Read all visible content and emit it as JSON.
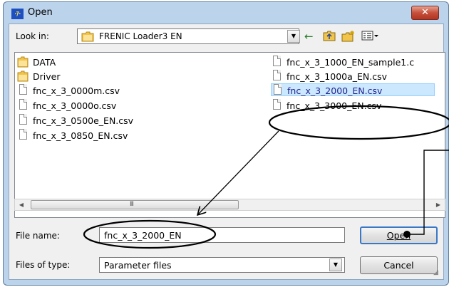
{
  "window": {
    "title": "Open",
    "app_icon_text": "·ｱ·",
    "close_glyph": "✕"
  },
  "look_in": {
    "label": "Look in:",
    "mnemonic_underline": "i",
    "value": "FRENIC Loader3 EN"
  },
  "toolbar": {
    "back_glyph": "←",
    "up_glyph": "⤴",
    "newfolder_glyph": "✳",
    "views_glyph": "☷"
  },
  "files": {
    "col1": [
      "DATA",
      "Driver",
      "fnc_x_3_0000m.csv",
      "fnc_x_3_0000o.csv",
      "fnc_x_3_0500e_EN.csv",
      "fnc_x_3_0850_EN.csv"
    ],
    "col1_folders": [
      true,
      true,
      false,
      false,
      false,
      false
    ],
    "col2": [
      "fnc_x_3_1000_EN_sample1.c",
      "fnc_x_3_1000a_EN.csv",
      "fnc_x_3_2000_EN.csv",
      "fnc_x_3_3000_EN.csv"
    ],
    "selected": "fnc_x_3_2000_EN.csv"
  },
  "scrollbar": {
    "grip_text": "III",
    "left_arrow": "◀",
    "right_arrow": "▶"
  },
  "file_name": {
    "label": "File name:",
    "value": "fnc_x_3_2000_EN"
  },
  "file_type": {
    "label": "Files of type:",
    "value": "Parameter files"
  },
  "buttons": {
    "open": "Open",
    "cancel": "Cancel"
  },
  "colors": {
    "selection": "#cce8ff",
    "titlebar": "#bcd3ec",
    "close": "#c6503c"
  }
}
